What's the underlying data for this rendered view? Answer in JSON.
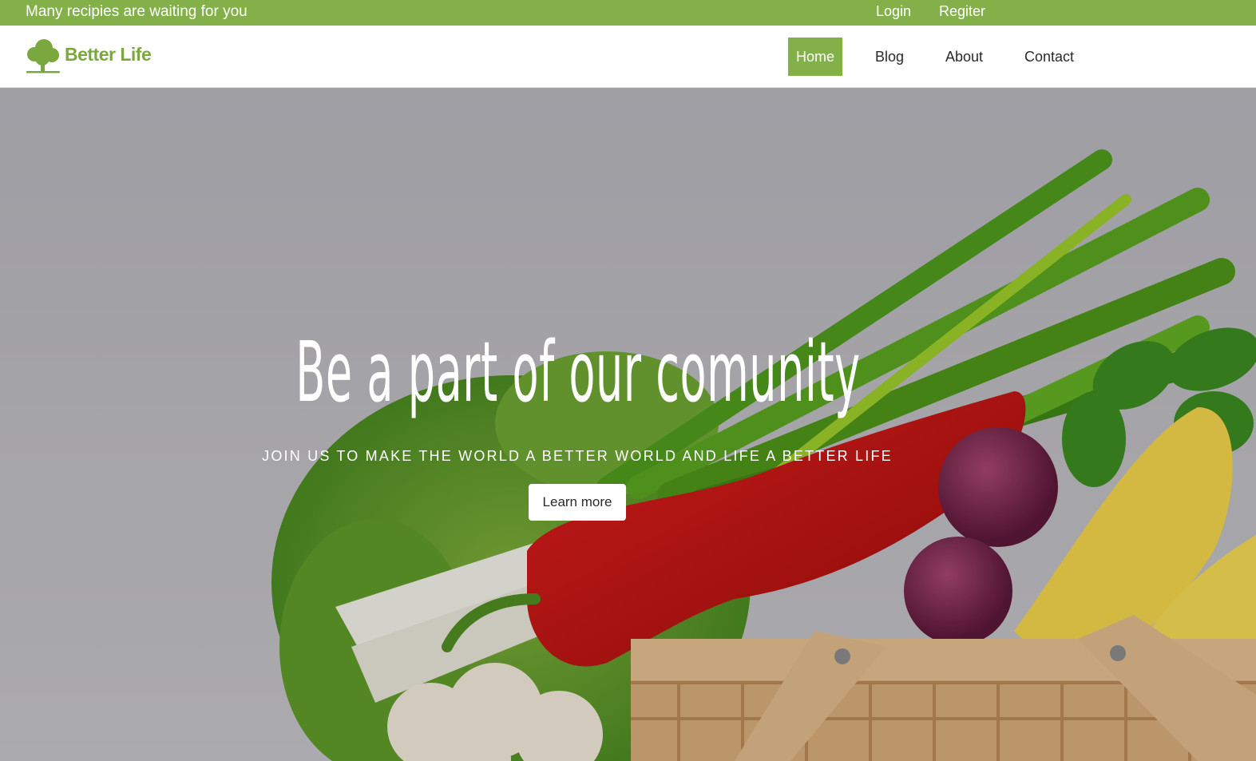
{
  "topbar": {
    "promo_text": "Many recipies are waiting for you",
    "login_label": "Login",
    "register_label": "Regiter"
  },
  "brand": {
    "name": "Better Life",
    "icon": "tree-icon",
    "color": "#7aa83f"
  },
  "nav": {
    "items": [
      {
        "label": "Home",
        "active": true
      },
      {
        "label": "Blog",
        "active": false
      },
      {
        "label": "About",
        "active": false
      },
      {
        "label": "Contact",
        "active": false
      }
    ],
    "active_color": "#84b04a"
  },
  "hero": {
    "title": "Be a part of our comunity",
    "subtitle": "JOIN US TO MAKE THE WORLD A BETTER WORLD AND LIFE A BETTER LIFE",
    "button_label": "Learn more",
    "background_image": "vegetable-basket-photo"
  },
  "colors": {
    "accent": "#84b04a",
    "text": "#2a2a2a"
  }
}
